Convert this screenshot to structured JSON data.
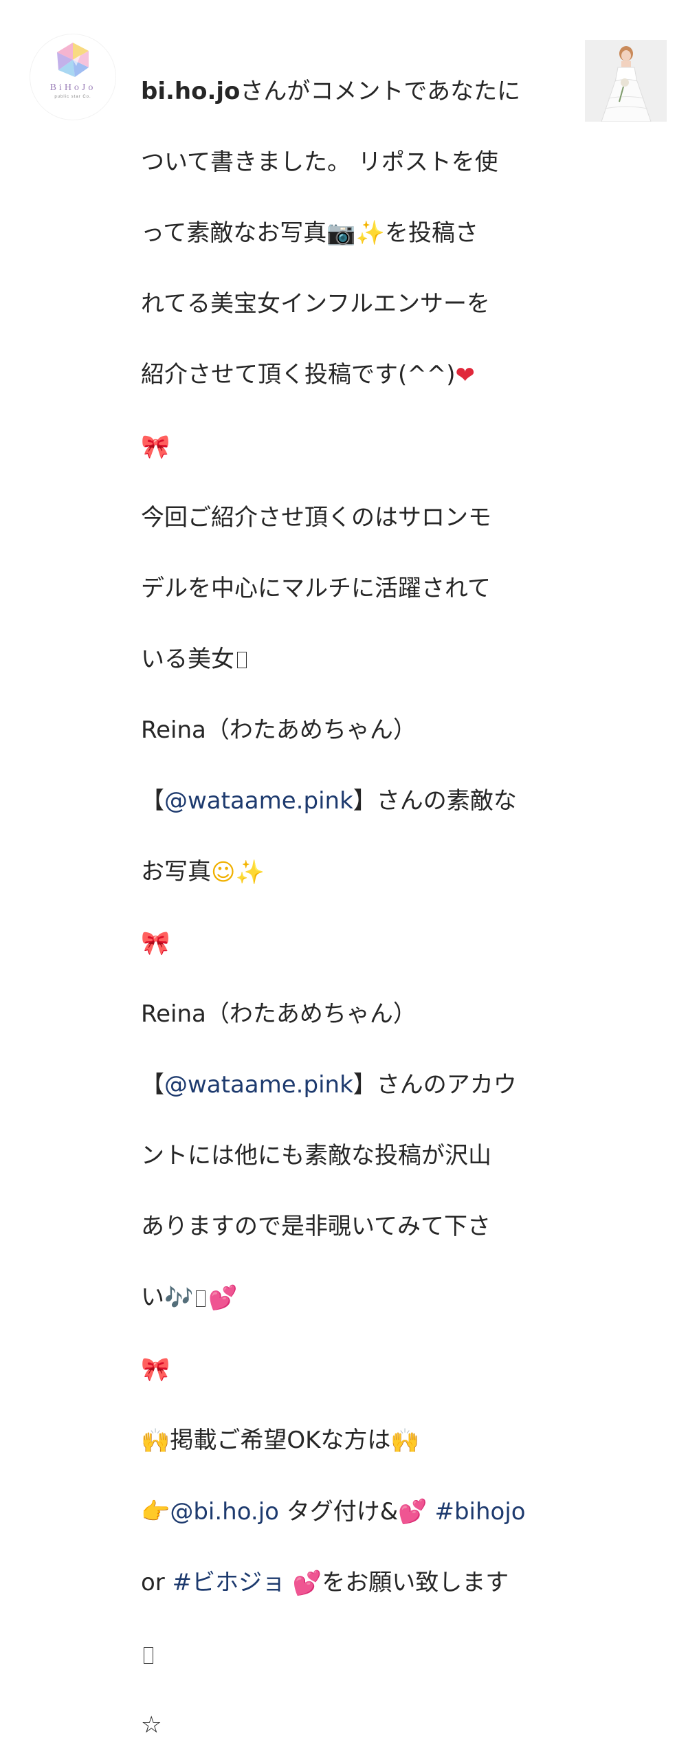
{
  "avatar": {
    "brand_name": "BiHoJo",
    "brand_sub": "public star Co."
  },
  "comment": {
    "username": "bi.ho.jo",
    "lines": {
      "l1": "さんがコメントであなたに",
      "l2": "ついて書きました。 リポストを使",
      "l3a": "って素敵なお写真",
      "l3b": "を投稿さ",
      "l4": "れてる美宝女インフルエンサーを",
      "l5": "紹介させて頂く投稿です(^^)",
      "l7": "今回ご紹介させ頂くのはサロンモ",
      "l8": "デルを中心にマルチに活躍されて",
      "l9": "いる美女",
      "l10": "Reina（わたあめちゃん）",
      "l11_open": "【",
      "l11_mention": "@wataame.pink",
      "l11_rest": "】さんの素敵な",
      "l12": "お写真",
      "l14": "Reina（わたあめちゃん）",
      "l15_open": "【",
      "l15_mention": "@wataame.pink",
      "l15_rest": "】さんのアカウ",
      "l16": "ントには他にも素敵な投稿が沢山",
      "l17": "ありますので是非覗いてみて下さ",
      "l18": "い",
      "l20": "掲載ご希望OKな方は",
      "l21_mention": "@bi.ho.jo",
      "l21_rest": " タグ付け&",
      "l21_tag": "#bihojo",
      "l22_pre": "or ",
      "l22_tag": "#ビホジョ",
      "l22_rest": "をお願い致します",
      "l24": "☆"
    }
  },
  "colors": {
    "text": "#262626",
    "link": "#1d3a6e",
    "emoji_red": "#e0283a"
  }
}
